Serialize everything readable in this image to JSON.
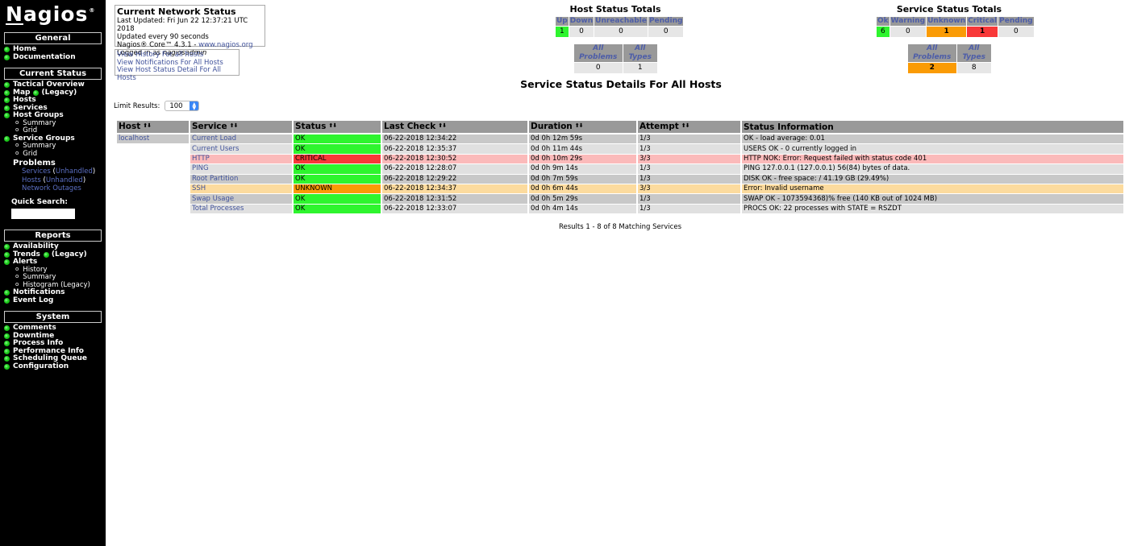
{
  "sidebar": {
    "logo": "Nagios",
    "logo_mark": "®",
    "sections": {
      "general": {
        "title": "General",
        "items": [
          "Home",
          "Documentation"
        ]
      },
      "current_status": {
        "title": "Current Status",
        "tactical": "Tactical Overview",
        "map": "Map",
        "map_legacy": "(Legacy)",
        "hosts": "Hosts",
        "services": "Services",
        "host_groups": "Host Groups",
        "host_groups_sub": [
          "Summary",
          "Grid"
        ],
        "service_groups": "Service Groups",
        "service_groups_sub": [
          "Summary",
          "Grid"
        ],
        "problems": "Problems",
        "problem_services": "Services",
        "problem_services_unhandled": "Unhandled",
        "problem_hosts": "Hosts",
        "problem_hosts_unhandled": "Unhandled",
        "network_outages": "Network Outages",
        "quick_search_label": "Quick Search:",
        "quick_search_value": ""
      },
      "reports": {
        "title": "Reports",
        "availability": "Availability",
        "trends": "Trends",
        "trends_legacy": "(Legacy)",
        "alerts": "Alerts",
        "alerts_sub": [
          "History",
          "Summary",
          "Histogram (Legacy)"
        ],
        "notifications": "Notifications",
        "event_log": "Event Log"
      },
      "system": {
        "title": "System",
        "items": [
          "Comments",
          "Downtime",
          "Process Info",
          "Performance Info",
          "Scheduling Queue",
          "Configuration"
        ]
      }
    }
  },
  "info": {
    "title": "Current Network Status",
    "last_updated": "Last Updated: Fri Jun 22 12:37:21 UTC 2018",
    "update_interval": "Updated every 90 seconds",
    "version_prefix": "Nagios® Core™ 4.3.1 - ",
    "version_link": "www.nagios.org",
    "logged_in_prefix": "Logged in as ",
    "user": "nagiosadmin",
    "links": [
      "View History For all hosts",
      "View Notifications For All Hosts",
      "View Host Status Detail For All Hosts"
    ]
  },
  "host_totals": {
    "title": "Host Status Totals",
    "headers": [
      "Up",
      "Down",
      "Unreachable",
      "Pending"
    ],
    "values": [
      "1",
      "0",
      "0",
      "0"
    ],
    "summary_headers": [
      "All Problems",
      "All Types"
    ],
    "summary_values": [
      "0",
      "1"
    ]
  },
  "service_totals": {
    "title": "Service Status Totals",
    "headers": [
      "Ok",
      "Warning",
      "Unknown",
      "Critical",
      "Pending"
    ],
    "values": [
      "6",
      "0",
      "1",
      "1",
      "0"
    ],
    "summary_headers": [
      "All Problems",
      "All Types"
    ],
    "summary_values": [
      "2",
      "8"
    ]
  },
  "main": {
    "title": "Service Status Details For All Hosts",
    "limit_label": "Limit Results:",
    "limit_value": "100",
    "columns": [
      "Host",
      "Service",
      "Status",
      "Last Check",
      "Duration",
      "Attempt",
      "Status Information"
    ],
    "host": "localhost",
    "rows": [
      {
        "service": "Current Load",
        "status": "OK",
        "last_check": "06-22-2018 12:34:22",
        "duration": "0d 0h 12m 59s",
        "attempt": "1/3",
        "info": "OK - load average: 0.01"
      },
      {
        "service": "Current Users",
        "status": "OK",
        "last_check": "06-22-2018 12:35:37",
        "duration": "0d 0h 11m 44s",
        "attempt": "1/3",
        "info": "USERS OK - 0 currently logged in"
      },
      {
        "service": "HTTP",
        "status": "CRITICAL",
        "last_check": "06-22-2018 12:30:52",
        "duration": "0d 0h 10m 29s",
        "attempt": "3/3",
        "info": "HTTP NOK: Error: Request failed with status code 401"
      },
      {
        "service": "PING",
        "status": "OK",
        "last_check": "06-22-2018 12:28:07",
        "duration": "0d 0h 9m 14s",
        "attempt": "1/3",
        "info": "PING 127.0.0.1 (127.0.0.1) 56(84) bytes of data."
      },
      {
        "service": "Root Partition",
        "status": "OK",
        "last_check": "06-22-2018 12:29:22",
        "duration": "0d 0h 7m 59s",
        "attempt": "1/3",
        "info": "DISK OK - free space: / 41.19 GB (29.49%)"
      },
      {
        "service": "SSH",
        "status": "UNKNOWN",
        "last_check": "06-22-2018 12:34:37",
        "duration": "0d 0h 6m 44s",
        "attempt": "3/3",
        "info": "Error: Invalid username"
      },
      {
        "service": "Swap Usage",
        "status": "OK",
        "last_check": "06-22-2018 12:31:52",
        "duration": "0d 0h 5m 29s",
        "attempt": "1/3",
        "info": "SWAP OK - 1073594368)% free (140 KB out of 1024 MB)"
      },
      {
        "service": "Total Processes",
        "status": "OK",
        "last_check": "06-22-2018 12:33:07",
        "duration": "0d 0h 4m 14s",
        "attempt": "1/3",
        "info": "PROCS OK: 22 processes with STATE = RSZDT"
      }
    ],
    "results": "Results 1 - 8 of 8 Matching Services"
  },
  "colors": {
    "ok": "#2ef52e",
    "critical": "#f83838",
    "unknown": "#fa9b05",
    "critical_row": "#fbbaba",
    "unknown_row": "#fcdb9e",
    "link": "#40529b"
  }
}
